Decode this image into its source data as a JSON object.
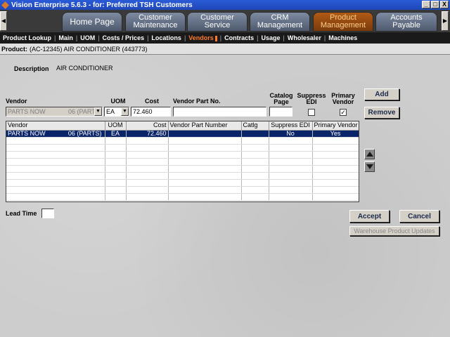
{
  "window": {
    "title": "Vision Enterprise 5.6.3 - for: Preferred TSH Customers",
    "controls": [
      "_",
      "□",
      "X"
    ]
  },
  "tabs": [
    {
      "label": "Home Page",
      "active": false
    },
    {
      "label": "Customer\nMaintenance",
      "active": false
    },
    {
      "label": "Customer\nService",
      "active": false
    },
    {
      "label": "CRM\nManagement",
      "active": false
    },
    {
      "label": "Product\nManagement",
      "active": true
    },
    {
      "label": "Accounts\nPayable",
      "active": false
    }
  ],
  "tab_arrows": {
    "left": "◀",
    "right": "▶"
  },
  "subnav": {
    "separator": "|",
    "items": [
      "Product Lookup",
      "Main",
      "UOM",
      "Costs / Prices",
      "Locations",
      "Vendors",
      "Contracts",
      "Usage",
      "Wholesaler",
      "Machines"
    ],
    "active": "Vendors"
  },
  "product": {
    "label": "Product:",
    "value": "(AC-12345)  AIR CONDITIONER (443773)"
  },
  "description": {
    "label": "Description",
    "value": "AIR CONDITIONER"
  },
  "form": {
    "labels": {
      "vendor": "Vendor",
      "uom": "UOM",
      "cost": "Cost",
      "vendor_part_no": "Vendor Part No.",
      "catalog_page": "Catalog\nPage",
      "suppress_edi": "Suppress\nEDI",
      "primary_vendor": "Primary\nVendor"
    },
    "vendor_value": "PARTS NOW",
    "vendor_code": "06 (PART",
    "uom_value": "EA",
    "cost_value": "72.460",
    "vendor_part_no_value": "",
    "catalog_page_value": "",
    "suppress_edi_checked": false,
    "primary_vendor_checked": true,
    "check_mark": "✓",
    "dropdown_arrow": "▼"
  },
  "buttons": {
    "add": "Add",
    "remove": "Remove",
    "accept": "Accept",
    "cancel": "Cancel",
    "warehouse_updates": "Warehouse Product Updates"
  },
  "grid": {
    "columns": [
      "Vendor",
      "UOM",
      "Cost",
      "Vendor Part Number",
      "Catlg",
      "Suppress EDI",
      "Primary Vendor"
    ],
    "rows": [
      {
        "vendor": "PARTS NOW",
        "vendor_code": "06 (PARTS)",
        "uom": "EA",
        "cost": "72.460",
        "part": "",
        "catlg": "",
        "suppress_edi": "No",
        "primary": "Yes",
        "selected": true
      }
    ],
    "empty_rows": 9
  },
  "lead_time": {
    "label": "Lead Time",
    "value": ""
  },
  "icons": {
    "move_up": "triangle-up-icon",
    "move_down": "triangle-down-icon"
  }
}
